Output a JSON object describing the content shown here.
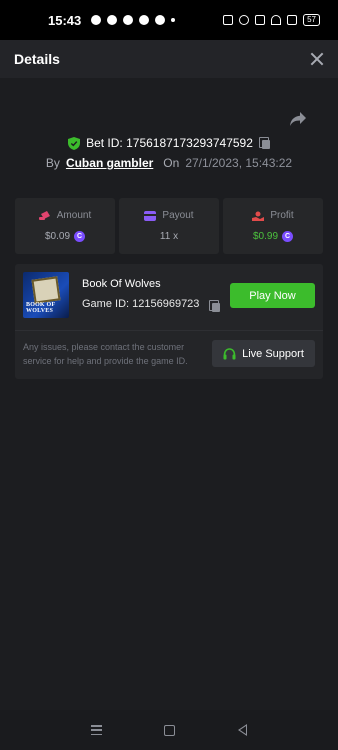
{
  "status_bar": {
    "time": "15:43",
    "battery": "57"
  },
  "header": {
    "title": "Details"
  },
  "bet": {
    "id_label": "Bet ID: 1756187173293747592",
    "by_label": "By",
    "user": "Cuban gambler",
    "on_label": "On",
    "date": "27/1/2023, 15:43:22"
  },
  "stats": {
    "amount": {
      "label": "Amount",
      "value": "$0.09"
    },
    "payout": {
      "label": "Payout",
      "value": "11 x"
    },
    "profit": {
      "label": "Profit",
      "value": "$0.99"
    }
  },
  "game": {
    "thumb_text": "BOOK OF WOLVES",
    "name": "Book Of Wolves",
    "id_label": "Game ID: 12156969723",
    "play_label": "Play Now",
    "support_text": "Any issues, please contact the customer service for help and provide the game ID.",
    "live_support_label": "Live Support"
  },
  "colors": {
    "accent_green": "#3cbc2c",
    "profit_green": "#4cc23e",
    "coin_purple": "#7a4dff",
    "amount_pink": "#e0446e",
    "payout_purple": "#8a5cf5",
    "profit_red": "#e24b4b"
  },
  "icons": {
    "share": "share-icon",
    "shield": "shield-check-icon",
    "copy": "copy-icon",
    "close": "close-icon",
    "headset": "headset-icon"
  }
}
